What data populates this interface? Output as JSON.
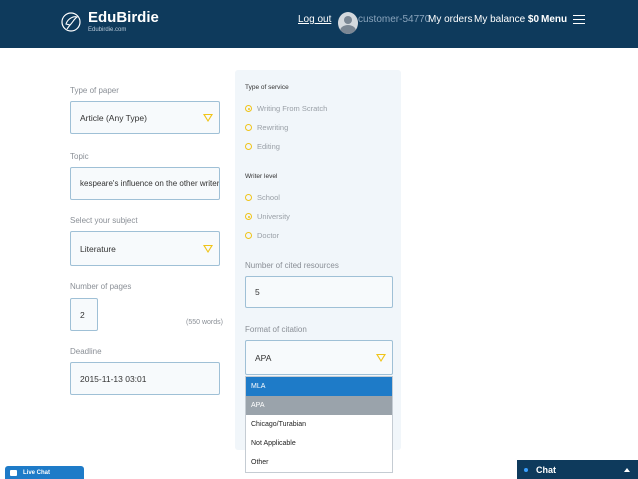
{
  "header": {
    "logo_title": "EduBirdie",
    "logo_sub": "Edubirdie.com",
    "logout": "Log out",
    "username": "customer-54770",
    "orders": "My orders",
    "balance_label": "My balance",
    "balance_value": "$0",
    "menu": "Menu"
  },
  "form": {
    "paper_type": {
      "label": "Type of paper",
      "value": "Article (Any Type)"
    },
    "topic": {
      "label": "Topic",
      "value": "kespeare's influence on the other writers"
    },
    "subject": {
      "label": "Select your subject",
      "value": "Literature"
    },
    "pages": {
      "label": "Number of pages",
      "value": "2",
      "words": "(550 words)"
    },
    "deadline": {
      "label": "Deadline",
      "value": "2015-11-13 03:01"
    }
  },
  "panel": {
    "service_title": "Type of service",
    "services": [
      {
        "label": "Writing From Scratch",
        "checked": true
      },
      {
        "label": "Rewriting",
        "checked": false
      },
      {
        "label": "Editing",
        "checked": false
      }
    ],
    "level_title": "Writer level",
    "levels": [
      {
        "label": "School",
        "checked": false
      },
      {
        "label": "University",
        "checked": true
      },
      {
        "label": "Doctor",
        "checked": false
      }
    ],
    "resources": {
      "label": "Number of cited resources",
      "value": "5"
    },
    "citation": {
      "label": "Format of citation",
      "value": "APA",
      "options": [
        "MLA",
        "APA",
        "Chicago/Turabian",
        "Not Applicable",
        "Other"
      ]
    }
  },
  "widgets": {
    "live_chat": "Live Chat",
    "chat": "Chat"
  },
  "colors": {
    "header_bg": "#0e3a5c",
    "accent_yellow": "#f0c419",
    "field_border": "#9fc0d6",
    "dropdown_active": "#1e7bc8"
  },
  "icons": [
    "bird-logo-icon",
    "avatar-icon",
    "hamburger-icon",
    "chevron-down-icon",
    "radio-icon",
    "chat-icon"
  ]
}
